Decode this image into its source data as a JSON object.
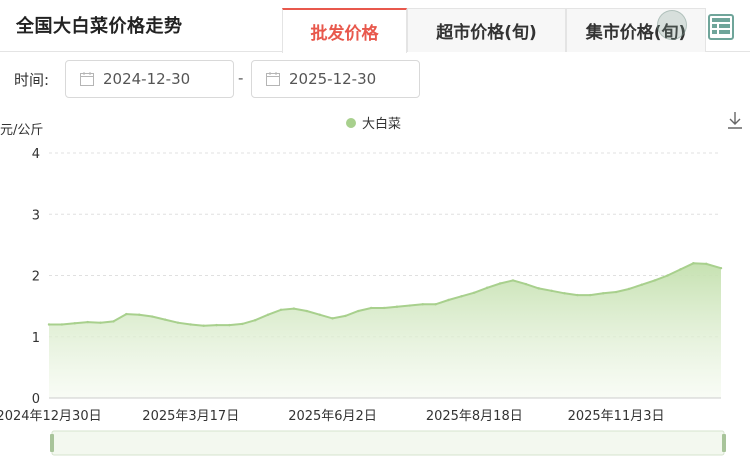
{
  "header": {
    "title": "全国大白菜价格走势",
    "tabs": [
      {
        "label": "批发价格",
        "active": true
      },
      {
        "label": "超市价格(旬)",
        "active": false
      },
      {
        "label": "集市价格(旬)",
        "active": false
      }
    ]
  },
  "date_range": {
    "label": "时间:",
    "start": "2024-12-30",
    "separator": "-",
    "end": "2025-12-30"
  },
  "colors": {
    "accent": "#e8584c",
    "series": "#a8d08d",
    "area_top": "#c3e0ad",
    "area_bottom": "#f4f9ef"
  },
  "chart_data": {
    "type": "area",
    "ylabel": "元/公斤",
    "ylim": [
      0,
      4
    ],
    "yticks": [
      0,
      1,
      2,
      3,
      4
    ],
    "xtick_labels": [
      "2024年12月30日",
      "2025年3月17日",
      "2025年6月2日",
      "2025年8月18日",
      "2025年11月3日"
    ],
    "xrange": [
      "2024-12-30",
      "2025-12-30"
    ],
    "legend": {
      "position": "top-center"
    },
    "grid": true,
    "series": [
      {
        "name": "大白菜",
        "x": [
          "2024-12-30",
          "2025-01-06",
          "2025-01-13",
          "2025-01-20",
          "2025-01-27",
          "2025-02-03",
          "2025-02-10",
          "2025-02-17",
          "2025-02-24",
          "2025-03-03",
          "2025-03-10",
          "2025-03-17",
          "2025-03-24",
          "2025-03-31",
          "2025-04-07",
          "2025-04-14",
          "2025-04-21",
          "2025-04-28",
          "2025-05-05",
          "2025-05-12",
          "2025-05-19",
          "2025-05-26",
          "2025-06-02",
          "2025-06-09",
          "2025-06-16",
          "2025-06-23",
          "2025-06-30",
          "2025-07-07",
          "2025-07-14",
          "2025-07-21",
          "2025-07-28",
          "2025-08-04",
          "2025-08-11",
          "2025-08-18",
          "2025-08-25",
          "2025-09-01",
          "2025-09-08",
          "2025-09-15",
          "2025-09-22",
          "2025-09-29",
          "2025-10-06",
          "2025-10-13",
          "2025-10-20",
          "2025-10-27",
          "2025-11-03",
          "2025-11-10",
          "2025-11-17",
          "2025-11-24",
          "2025-12-01",
          "2025-12-08",
          "2025-12-15",
          "2025-12-22",
          "2025-12-30"
        ],
        "values": [
          1.2,
          1.2,
          1.22,
          1.24,
          1.23,
          1.25,
          1.37,
          1.36,
          1.33,
          1.28,
          1.23,
          1.2,
          1.18,
          1.19,
          1.19,
          1.21,
          1.27,
          1.36,
          1.44,
          1.46,
          1.42,
          1.36,
          1.3,
          1.34,
          1.42,
          1.47,
          1.47,
          1.49,
          1.51,
          1.53,
          1.53,
          1.6,
          1.66,
          1.72,
          1.8,
          1.87,
          1.92,
          1.86,
          1.79,
          1.75,
          1.71,
          1.68,
          1.68,
          1.71,
          1.73,
          1.78,
          1.85,
          1.92,
          2.0,
          2.1,
          2.2,
          2.19,
          2.12
        ]
      }
    ]
  }
}
